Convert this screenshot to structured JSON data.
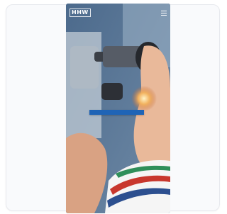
{
  "screenshot": {
    "brand_logo": "HHW",
    "top_nav_text": "",
    "menu_icon": "hamburger-menu-icon",
    "caption_lines": [
      "",
      "",
      ""
    ],
    "colors": {
      "caption_background": "#1f64b6",
      "card_border": "#e7e9ee",
      "card_background": "#f9fafc"
    }
  }
}
